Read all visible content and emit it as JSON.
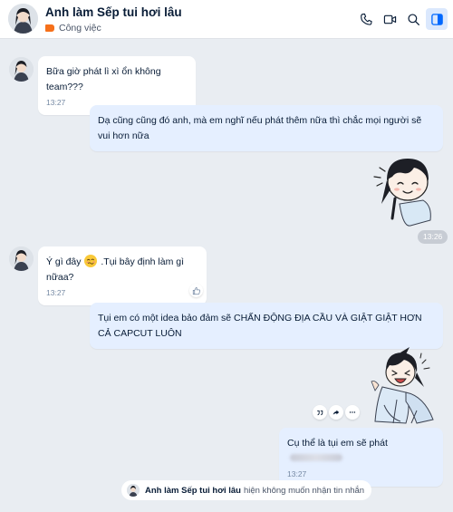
{
  "header": {
    "title": "Anh làm Sếp tui hơi lâu",
    "tag_label": "Công việc",
    "tag_color": "#f6701a",
    "icons": [
      "phone-icon",
      "video-call-icon",
      "search-icon",
      "sidebar-toggle-icon"
    ]
  },
  "messages": [
    {
      "from": "them",
      "text": "Bữa giờ phát lì xì ổn không team???",
      "time": "13:27"
    },
    {
      "from": "me",
      "text": "Dạ cũng cũng đó anh, mà em nghĩ nếu phát thêm nữa thì chắc mọi người sẽ vui hơn nữa"
    },
    {
      "from": "me",
      "sticker": "sticker-smiling-boy"
    },
    {
      "separator_time": "13:26"
    },
    {
      "from": "them",
      "text_before": "Ý gì đây",
      "emoji": "woozy-face-emoji",
      "text_after": ".Tụi bây định làm gì nữaa?",
      "time": "13:27",
      "reaction": "like-icon"
    },
    {
      "from": "me",
      "text": "Tụi em có một idea bảo đảm sẽ CHẤN ĐỘNG ĐỊA CẦU VÀ GIẬT GIẬT HƠN CẢ CAPCUT LUÔN"
    },
    {
      "from": "me",
      "sticker": "sticker-laughing-boy",
      "actions": [
        "quote-icon",
        "forward-icon",
        "more-icon"
      ]
    },
    {
      "from": "me",
      "text": "Cụ thể là tụi em sẽ phát",
      "hidden_tail": "blurred",
      "time": "13:27"
    }
  ],
  "status": {
    "name": "Anh làm Sếp tui hơi lâu",
    "text": "hiện không muốn nhận tin nhắn"
  },
  "colors": {
    "background": "#e9edf2",
    "incoming_bubble": "#ffffff",
    "outgoing_bubble": "#e5efff",
    "accent": "#0068ff"
  }
}
